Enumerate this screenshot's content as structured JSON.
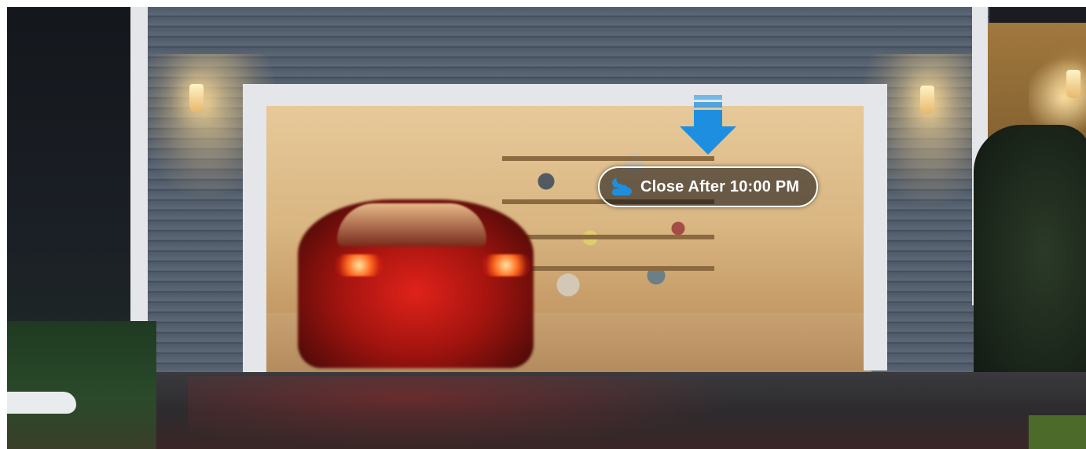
{
  "banner": {
    "close_label": "Close After 10:00 PM",
    "icon": "moon-cloud-icon",
    "arrow_icon": "down-arrow-icon"
  },
  "colors": {
    "accent_blue": "#1e8fe0",
    "pill_border": "#ffffff",
    "pill_text": "#ffffff"
  }
}
